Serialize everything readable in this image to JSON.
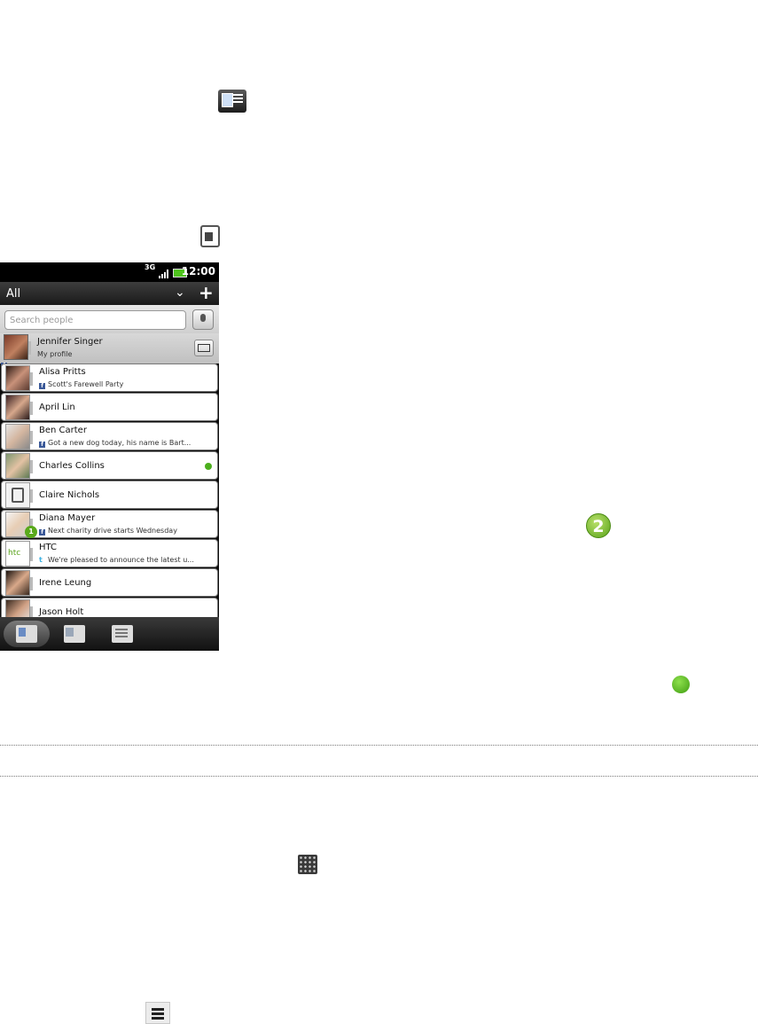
{
  "document": {
    "icons": [
      "people-icon",
      "sim-card-icon",
      "numbered-badge-icon",
      "online-status-icon",
      "all-apps-icon",
      "menu-icon"
    ],
    "badge_number": "2"
  },
  "phone": {
    "status_bar": {
      "network": "3G",
      "time": "12:00"
    },
    "header": {
      "filter_label": "All",
      "chevron": "⌄",
      "add": "+"
    },
    "search": {
      "placeholder": "Search people"
    },
    "profile": {
      "name": "Jennifer Singer",
      "subtitle": "My profile"
    },
    "contacts": [
      {
        "name": "Alisa Pritts",
        "status": "Scott's Farewell Party",
        "source": "f"
      },
      {
        "name": "April Lin"
      },
      {
        "name": "Ben Carter",
        "status": "Got a new dog today, his name is Bart...",
        "source": "f"
      },
      {
        "name": "Charles Collins",
        "online": true
      },
      {
        "name": "Claire Nichols"
      },
      {
        "name": "Diana Mayer",
        "status": "Next charity drive starts Wednesday",
        "source": "f",
        "badge": "1"
      },
      {
        "name": "HTC",
        "status": "We're pleased to announce the latest u...",
        "source": "t",
        "avatar_text": "htc"
      },
      {
        "name": "Irene Leung"
      },
      {
        "name": "Jason Holt"
      }
    ],
    "tabs": [
      "people-tab",
      "groups-tab",
      "call-history-tab"
    ]
  }
}
